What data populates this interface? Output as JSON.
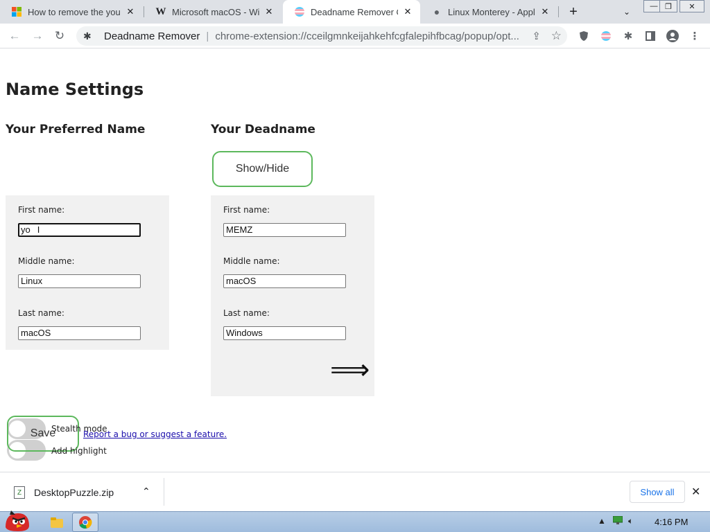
{
  "browser": {
    "tabs": [
      {
        "title": "How to remove the you",
        "favicon": "windows-icon"
      },
      {
        "title": "Microsoft macOS - Wik",
        "favicon": "wikipedia-icon"
      },
      {
        "title": "Deadname Remover O",
        "favicon": "extension-flag-icon"
      },
      {
        "title": "Linux Monterey - Apple",
        "favicon": "apple-icon"
      }
    ],
    "active_tab": 2,
    "omnibox": {
      "site": "Deadname Remover",
      "url": "chrome-extension://cceilgmnkeijahkehfcgfalepihfbcag/popup/opt..."
    }
  },
  "page": {
    "title": "Name Settings",
    "preferred": {
      "heading": "Your Preferred Name",
      "first_label": "First name:",
      "first_value": "yo",
      "middle_label": "Middle name:",
      "middle_value": "Linux",
      "last_label": "Last name:",
      "last_value": "macOS"
    },
    "deadname": {
      "heading": "Your Deadname",
      "show_hide_label": "Show/Hide",
      "first_label": "First name:",
      "first_value": "MEMZ",
      "middle_label": "Middle name:",
      "middle_value": "macOS",
      "last_label": "Last name:",
      "last_value": "Windows",
      "arrow": "⟹"
    },
    "save_label": "Save",
    "stealth_label": "Stealth mode",
    "highlight_label": "Add highlight",
    "bug_link": "Report a bug or suggest a feature."
  },
  "downloads": {
    "file": "DesktopPuzzle.zip",
    "show_all": "Show all"
  },
  "taskbar": {
    "time": "4:16 PM"
  },
  "colors": {
    "accent_green": "#5cb85c",
    "panel_bg": "#f1f1f1",
    "link": "#1a0dab"
  }
}
